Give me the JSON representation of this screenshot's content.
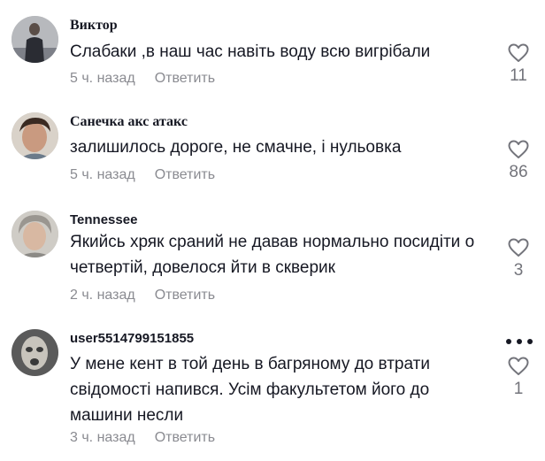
{
  "comments": [
    {
      "username": "Виктор",
      "text": "Слабаки ,в наш час навіть воду всю вигрібали",
      "time": "5 ч. назад",
      "reply_label": "Ответить",
      "likes": "11",
      "avatar_color": "#3a3d4a"
    },
    {
      "username": "Санечка акс атакс",
      "text": "залишилось дороге, не смачне, і нульовка",
      "time": "5 ч. назад",
      "reply_label": "Ответить",
      "likes": "86",
      "avatar_color": "#8b6f5c"
    },
    {
      "username": "Tennessee",
      "text": "Якийсь хряк сраний не давав нормально посидіти о четвертій, довелося йти в скверик",
      "time": "2 ч. назад",
      "reply_label": "Ответить",
      "likes": "3",
      "avatar_color": "#a9a6a0"
    },
    {
      "username": "user5514799151855",
      "text": "У мене кент в той день в багряному до втрати свідомості напився. Усім факультетом його до машини несли",
      "time": "3 ч. назад",
      "reply_label": "Ответить",
      "likes": "1",
      "avatar_color": "#4a4a4a"
    }
  ],
  "icons": {
    "like": "heart-outline-icon",
    "more": "more-horizontal-icon"
  },
  "colors": {
    "text": "#161823",
    "meta": "#8a8b91",
    "icon": "#73747b"
  }
}
